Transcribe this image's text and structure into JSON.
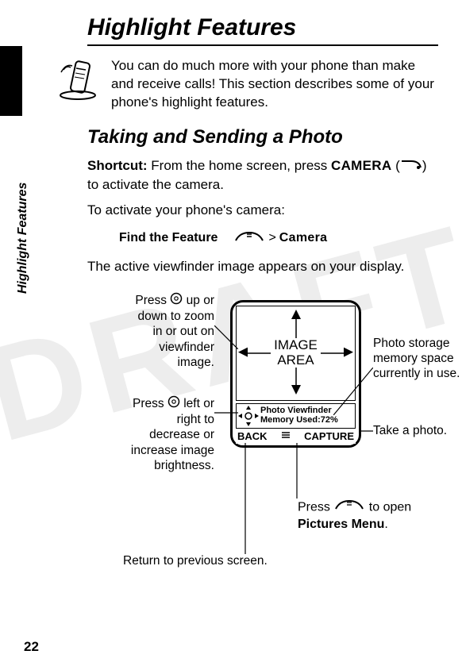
{
  "page_number": "22",
  "side_label": "Highlight Features",
  "watermark": "DRAFT",
  "title": "Highlight Features",
  "intro": "You can do much more with your phone than make and receive calls! This section describes some of your phone's highlight features.",
  "section_title": "Taking and Sending a Photo",
  "shortcut_label": "Shortcut:",
  "shortcut_text_before": " From the home screen, press ",
  "shortcut_key": "CAMERA",
  "shortcut_text_after": " to activate the camera.",
  "activate_text": "To activate your phone's camera:",
  "find_feature_label": "Find the Feature",
  "menu_path_gt": ">",
  "menu_path_item": "Camera",
  "viewfinder_text": "The active viewfinder image appears on your display.",
  "diagram": {
    "image_area_l1": "IMAGE",
    "image_area_l2": "AREA",
    "info_line1": "Photo Viewfinder",
    "info_line2": "Memory Used:72%",
    "softkey_left": "BACK",
    "softkey_right": "CAPTURE",
    "callouts": {
      "zoom": "Press      up or down to zoom in or out on viewfinder image.",
      "zoom_l1": "Press",
      "zoom_l1b": " up or",
      "zoom_l2": "down to zoom",
      "zoom_l3": "in or out on",
      "zoom_l4": "viewfinder",
      "zoom_l5": "image.",
      "brightness_l1": "Press",
      "brightness_l1b": " left or",
      "brightness_l2": "right to",
      "brightness_l3": "decrease or",
      "brightness_l4": "increase image",
      "brightness_l5": "brightness.",
      "storage_l1": "Photo storage",
      "storage_l2": "memory space",
      "storage_l3": "currently in use.",
      "take_photo": "Take a photo.",
      "pictures_pre": "Press ",
      "pictures_post": " to open",
      "pictures_menu": "Pictures Menu",
      "pictures_dot": ".",
      "return": "Return to previous screen."
    }
  }
}
